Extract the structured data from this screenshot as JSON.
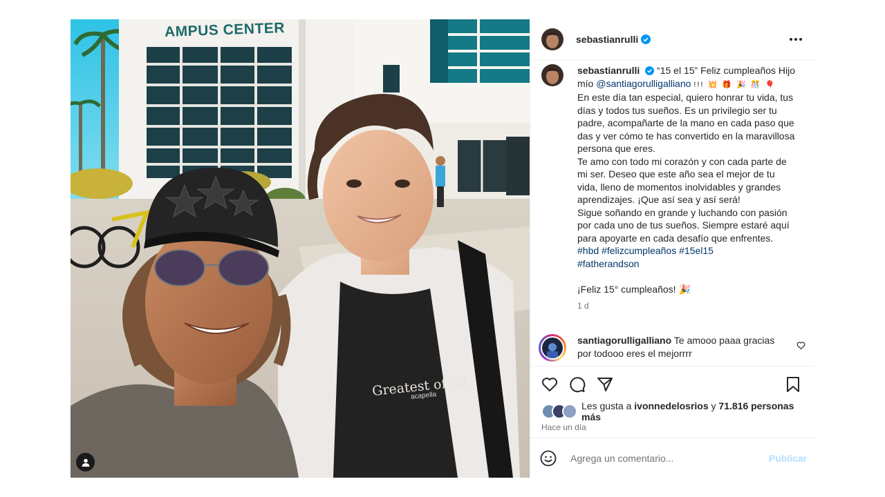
{
  "photo": {
    "sign_text": "AMPUS CENTER",
    "shirt_text": "Greatest of all",
    "shirt_sub": "acapella",
    "tag_icon": "person-icon"
  },
  "header": {
    "username": "sebastianrulli",
    "more_icon": "more-dots-icon"
  },
  "caption": {
    "username": "sebastianrulli",
    "title": "“15 el 15”",
    "line_greeting": "Feliz cumpleaños Hijo mío ",
    "mention": "@santiagorulligalliano",
    "emojis": "!!! 💥 🎁 🎉 🎊 🎈",
    "para1": "En este día tan especial, quiero honrar tu vida, tus días y todos tus sueños. Es un privilegio ser tu padre, acompañarte de la mano en cada paso que das y ver cómo te has convertido en la maravillosa persona que eres.",
    "para2": "Te amo con todo mi corazón y con cada parte de mi ser. Deseo que este año sea el mejor de tu vida, lleno de momentos inolvidables y grandes aprendizajes. ¡Que así sea y así será!",
    "para3": "Sigue soñando en grande y luchando con pasión por cada uno de tus sueños. Siempre estaré aquí para apoyarte en cada desafío que enfrentes.",
    "hashtags_line1": [
      "#hbd",
      "#felizcumpleaños",
      "#15el15"
    ],
    "hashtags_line2": [
      "#fatherandson"
    ],
    "closing": "¡Feliz 15° cumpleaños! 🎉",
    "time": "1 d"
  },
  "reply": {
    "username": "santiagorulligalliano",
    "text": " Te amooo paaa gracias por todooo eres el mejorrrr"
  },
  "likes": {
    "prefix": "Les gusta a ",
    "user": "ivonnedelosrios",
    "middle": " y ",
    "count": "71.816 personas más"
  },
  "posted_ago": "Hace un día",
  "comment_box": {
    "placeholder": "Agrega un comentario...",
    "publish_label": "Publicar"
  },
  "colors": {
    "link": "#00376b",
    "verified": "#0095f6",
    "publish_disabled": "#b2dffc"
  }
}
